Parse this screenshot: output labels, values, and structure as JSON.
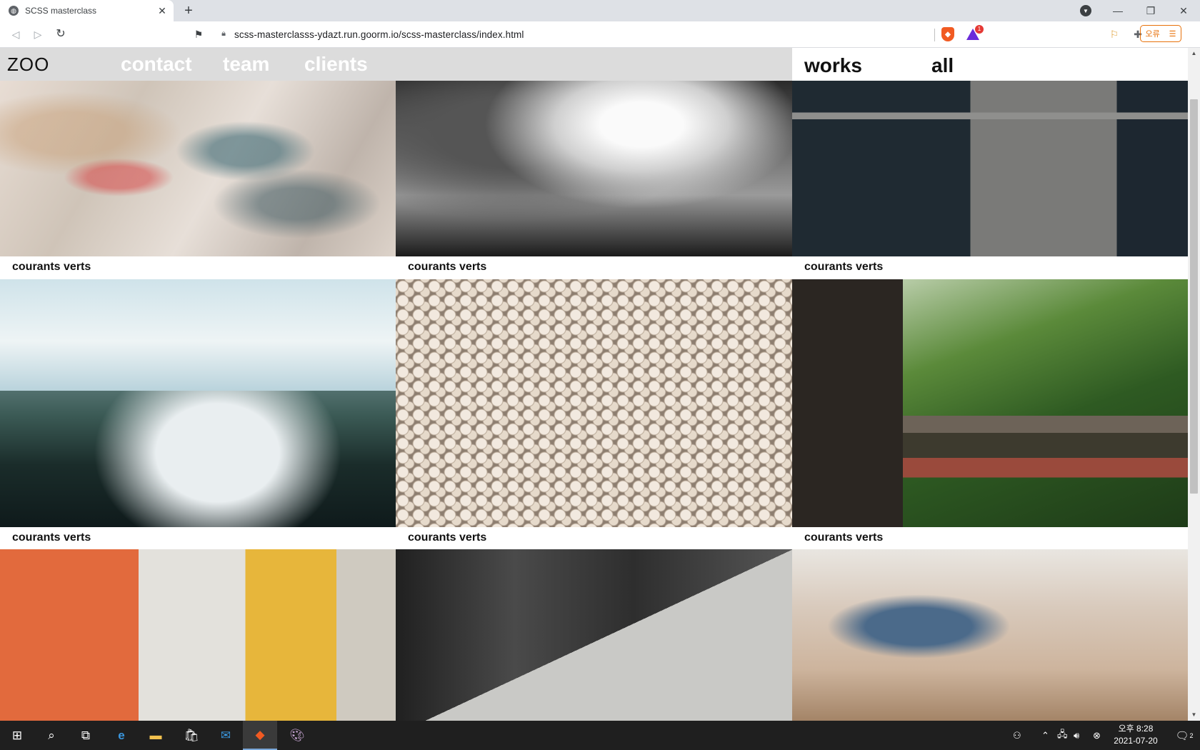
{
  "browser": {
    "tab_title": "SCSS masterclass",
    "new_tab": "+",
    "url": "scss-masterclasss-ydazt.run.goorm.io/scss-masterclass/index.html",
    "notification_count": "1",
    "error_button": "오류"
  },
  "site": {
    "brand": "ZOO",
    "nav": [
      "contact",
      "team",
      "clients"
    ],
    "right_nav": {
      "works": "works",
      "all": "all"
    }
  },
  "gallery": {
    "items": [
      {
        "caption": "courants verts",
        "image": "abstract-paint"
      },
      {
        "caption": "courants verts",
        "image": "forest-bw"
      },
      {
        "caption": "courants verts",
        "image": "concrete-blocks"
      },
      {
        "caption": "courants verts",
        "image": "foggy-forest"
      },
      {
        "caption": "courants verts",
        "image": "pebbles"
      },
      {
        "caption": "courants verts",
        "image": "canyon-bridge"
      },
      {
        "caption": "",
        "image": "colorful-buildings"
      },
      {
        "caption": "",
        "image": "concrete-wall"
      },
      {
        "caption": "",
        "image": "fishing-pier"
      }
    ]
  },
  "taskbar": {
    "clock_time": "오후 8:28",
    "clock_date": "2021-07-20",
    "notification_badge": "2"
  }
}
